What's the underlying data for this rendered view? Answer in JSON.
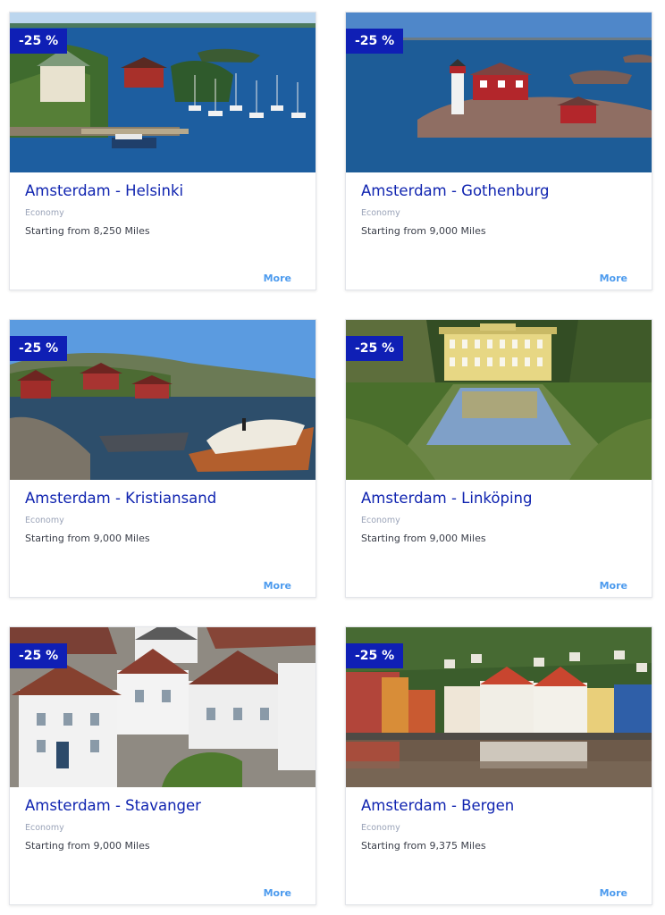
{
  "deals": [
    {
      "badge": "-25 %",
      "route": "Amsterdam - Helsinki",
      "cabin": "Economy",
      "price": "Starting from 8,250 Miles",
      "more_label": "More",
      "photo": "helsinki-harbour-photo"
    },
    {
      "badge": "-25 %",
      "route": "Amsterdam - Gothenburg",
      "cabin": "Economy",
      "price": "Starting from 9,000 Miles",
      "more_label": "More",
      "photo": "gothenburg-lighthouse-photo"
    },
    {
      "badge": "-25 %",
      "route": "Amsterdam - Kristiansand",
      "cabin": "Economy",
      "price": "Starting from 9,000 Miles",
      "more_label": "More",
      "photo": "kristiansand-boats-photo"
    },
    {
      "badge": "-25 %",
      "route": "Amsterdam - Linköping",
      "cabin": "Economy",
      "price": "Starting from 9,000 Miles",
      "more_label": "More",
      "photo": "linkoping-manor-photo"
    },
    {
      "badge": "-25 %",
      "route": "Amsterdam - Stavanger",
      "cabin": "Economy",
      "price": "Starting from 9,000 Miles",
      "more_label": "More",
      "photo": "stavanger-houses-photo"
    },
    {
      "badge": "-25 %",
      "route": "Amsterdam - Bergen",
      "cabin": "Economy",
      "price": "Starting from 9,375 Miles",
      "more_label": "More",
      "photo": "bergen-waterfront-photo"
    }
  ],
  "colors": {
    "badge_bg": "#0f1fb5",
    "title": "#1024b0",
    "link": "#4d9bee"
  }
}
